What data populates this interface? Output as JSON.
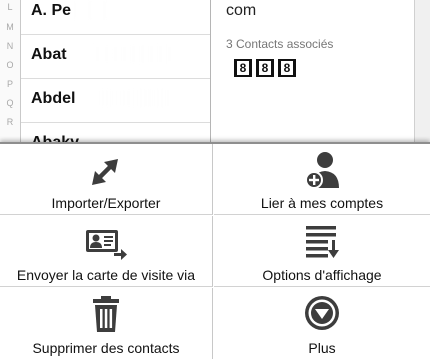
{
  "index_rail": {
    "letters": [
      "L",
      "M",
      "N",
      "O",
      "P",
      "Q",
      "R"
    ]
  },
  "contacts": [
    {
      "name": "A. Pe"
    },
    {
      "name": "Abat"
    },
    {
      "name": "Abdel"
    },
    {
      "name": "Abaky"
    }
  ],
  "detail": {
    "top_text": "com",
    "linked_count": "3 Contacts associés",
    "account_badges": [
      "8",
      "8",
      "8"
    ]
  },
  "menu": {
    "import_export": {
      "label": "Importer/Exporter",
      "icon": "import-export-arrows-icon"
    },
    "link_accounts": {
      "label": "Lier à mes comptes",
      "icon": "link-account-person-icon"
    },
    "send_card": {
      "label": "Envoyer la carte de visite via",
      "icon": "business-card-send-icon"
    },
    "display_options": {
      "label": "Options d'affichage",
      "icon": "list-sort-icon"
    },
    "delete_contacts": {
      "label": "Supprimer des contacts",
      "icon": "trash-icon"
    },
    "more": {
      "label": "Plus",
      "icon": "chevron-down-circle-icon"
    }
  }
}
